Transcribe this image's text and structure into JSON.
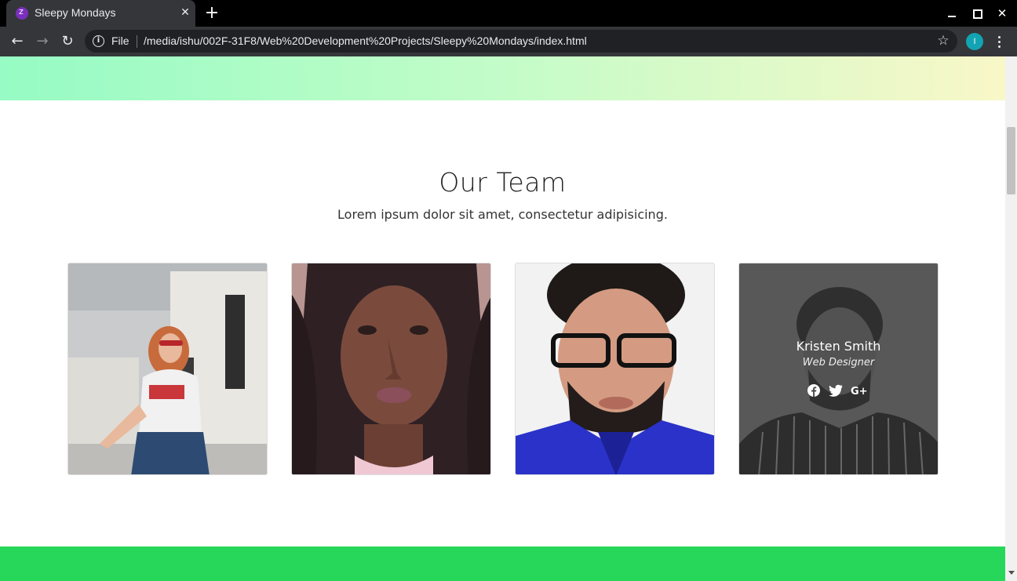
{
  "browser": {
    "tab_title": "Sleepy Mondays",
    "tab_close": "✕",
    "new_tab": "+",
    "scheme_label": "File",
    "url": "/media/ishu/002F-31F8/Web%20Development%20Projects/Sleepy%20Mondays/index.html",
    "profile_initial": "I",
    "back_icon": "←",
    "forward_icon": "→",
    "reload_icon": "↻",
    "star_icon": "☆",
    "info_icon": "i",
    "close_window": "✕"
  },
  "team_section": {
    "title": "Our Team",
    "subtitle": "Lorem ipsum dolor sit amet, consectetur adipisicing."
  },
  "team_members": [
    {
      "photo": "woman-red-hair-sunglasses"
    },
    {
      "photo": "woman-curly-hair-portrait"
    },
    {
      "photo": "man-glasses-blue-shirt"
    },
    {
      "photo": "man-curly-hair-striped-shirt",
      "name": "Kristen Smith",
      "role": "Web Designer",
      "social": [
        "facebook-icon",
        "twitter-icon",
        "google-plus-icon"
      ],
      "google_plus_label": "G+"
    }
  ],
  "colors": {
    "green_band": "#27d75a",
    "gradient_start": "#96fbc4",
    "gradient_end": "#f9f7c8"
  }
}
